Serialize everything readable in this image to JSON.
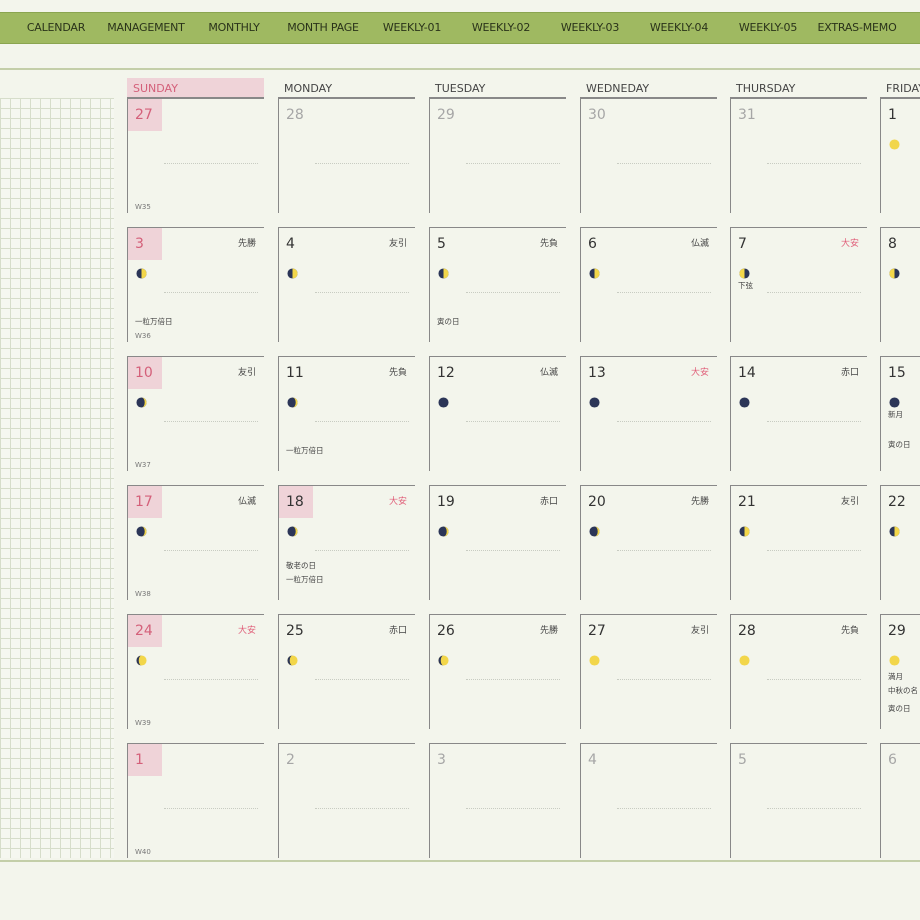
{
  "nav": {
    "tabs": [
      {
        "label": "CALENDAR"
      },
      {
        "label": "MANAGEMENT"
      },
      {
        "label": "MONTHLY"
      },
      {
        "label": "MONTH PAGE"
      },
      {
        "label": "WEEKLY-01"
      },
      {
        "label": "WEEKLY-02"
      },
      {
        "label": "WEEKLY-03"
      },
      {
        "label": "WEEKLY-04"
      },
      {
        "label": "WEEKLY-05"
      },
      {
        "label": "EXTRAS-MEMO"
      }
    ]
  },
  "calendar": {
    "day_headers": [
      "SUNDAY",
      "MONDAY",
      "TUESDAY",
      "WEDNEDAY",
      "THURSDAY",
      "FRIDAY"
    ],
    "weeks": [
      {
        "label": "W35",
        "days": [
          {
            "num": "27",
            "dim": true
          },
          {
            "num": "28",
            "dim": true
          },
          {
            "num": "29",
            "dim": true
          },
          {
            "num": "30",
            "dim": true
          },
          {
            "num": "31",
            "dim": true
          },
          {
            "num": "1",
            "moon": "full"
          }
        ]
      },
      {
        "label": "W36",
        "days": [
          {
            "num": "3",
            "rokuyo": "先勝",
            "moon": "first-quarter",
            "notes": [
              "一粒万倍日"
            ]
          },
          {
            "num": "4",
            "rokuyo": "友引",
            "moon": "first-quarter"
          },
          {
            "num": "5",
            "rokuyo": "先負",
            "moon": "first-quarter",
            "notes": [
              "寅の日"
            ]
          },
          {
            "num": "6",
            "rokuyo": "仏滅",
            "moon": "first-quarter"
          },
          {
            "num": "7",
            "rokuyo": "大安",
            "rokuyo_red": true,
            "moon": "last-quarter",
            "notes": [
              "下弦"
            ]
          },
          {
            "num": "8",
            "moon": "last-quarter"
          }
        ]
      },
      {
        "label": "W37",
        "days": [
          {
            "num": "10",
            "rokuyo": "友引",
            "moon": "crescent"
          },
          {
            "num": "11",
            "rokuyo": "先負",
            "moon": "crescent",
            "notes": [
              "一粒万倍日"
            ]
          },
          {
            "num": "12",
            "rokuyo": "仏滅",
            "moon": "new"
          },
          {
            "num": "13",
            "rokuyo": "大安",
            "rokuyo_red": true,
            "moon": "new"
          },
          {
            "num": "14",
            "rokuyo": "赤口",
            "moon": "new"
          },
          {
            "num": "15",
            "moon": "new",
            "notes": [
              "新月",
              "寅の日"
            ]
          }
        ]
      },
      {
        "label": "W38",
        "days": [
          {
            "num": "17",
            "rokuyo": "仏滅",
            "moon": "crescent"
          },
          {
            "num": "18",
            "rokuyo": "大安",
            "rokuyo_red": true,
            "moon": "crescent",
            "notes": [
              "敬老の日",
              "一粒万倍日"
            ]
          },
          {
            "num": "19",
            "rokuyo": "赤口",
            "moon": "crescent"
          },
          {
            "num": "20",
            "rokuyo": "先勝",
            "moon": "crescent"
          },
          {
            "num": "21",
            "rokuyo": "友引",
            "moon": "first-quarter"
          },
          {
            "num": "22",
            "moon": "first-quarter"
          }
        ]
      },
      {
        "label": "W39",
        "days": [
          {
            "num": "24",
            "rokuyo": "大安",
            "rokuyo_red": true,
            "moon": "gibbous"
          },
          {
            "num": "25",
            "rokuyo": "赤口",
            "moon": "gibbous"
          },
          {
            "num": "26",
            "rokuyo": "先勝",
            "moon": "gibbous"
          },
          {
            "num": "27",
            "rokuyo": "友引",
            "moon": "full"
          },
          {
            "num": "28",
            "rokuyo": "先負",
            "moon": "full"
          },
          {
            "num": "29",
            "moon": "full",
            "notes": [
              "満月",
              "中秋の名",
              "寅の日"
            ]
          }
        ]
      },
      {
        "label": "W40",
        "days": [
          {
            "num": "1",
            "dim": true
          },
          {
            "num": "2",
            "dim": true
          },
          {
            "num": "3",
            "dim": true
          },
          {
            "num": "4",
            "dim": true
          },
          {
            "num": "5",
            "dim": true
          },
          {
            "num": "6",
            "dim": true
          }
        ]
      }
    ]
  },
  "colors": {
    "accent": "#9fb961",
    "holiday_bg": "#efd3d8",
    "holiday_text": "#d4607a",
    "moon_yellow": "#f2d64a",
    "moon_dark": "#2b3557"
  }
}
